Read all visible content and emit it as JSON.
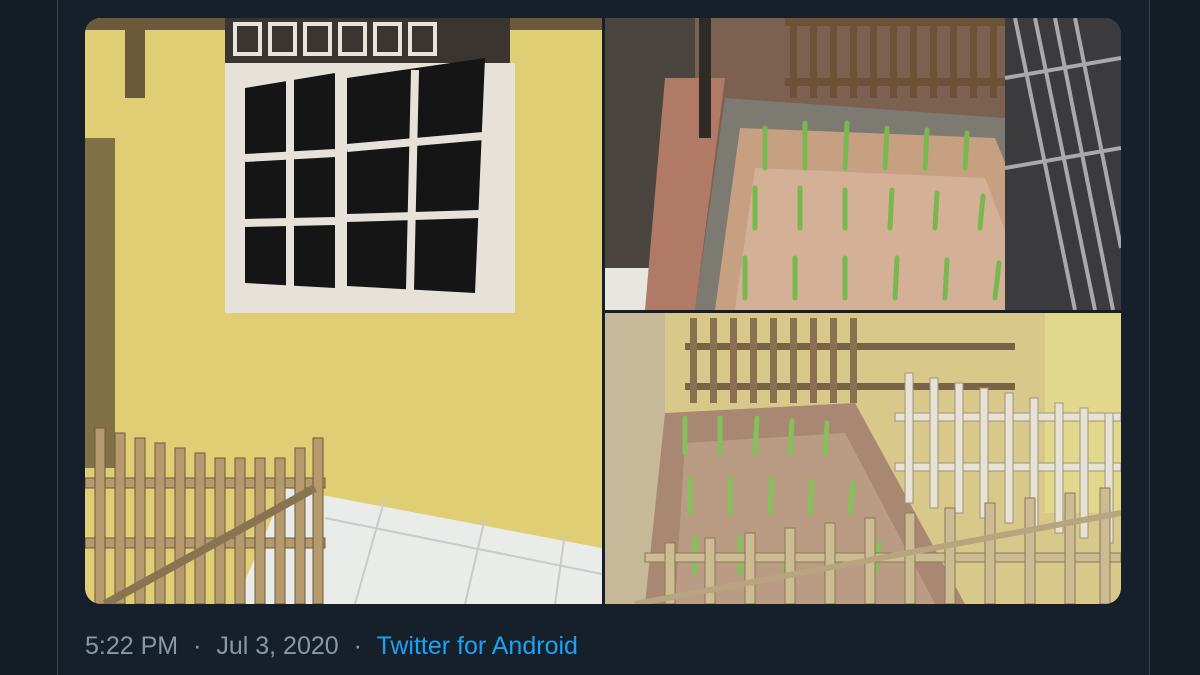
{
  "tweet": {
    "time": "5:22 PM",
    "separator": "·",
    "date": "Jul 3, 2020",
    "source": "Twitter for Android"
  },
  "media": {
    "photos": [
      {
        "subject": "yellow wall with window and picket fence"
      },
      {
        "subject": "rice seedlings in flooded fenced plot"
      },
      {
        "subject": "rice seedlings in fenced plot, wide view"
      }
    ]
  },
  "colors": {
    "background": "#15202b",
    "meta_text": "#8899a6",
    "link": "#1da1f2"
  }
}
